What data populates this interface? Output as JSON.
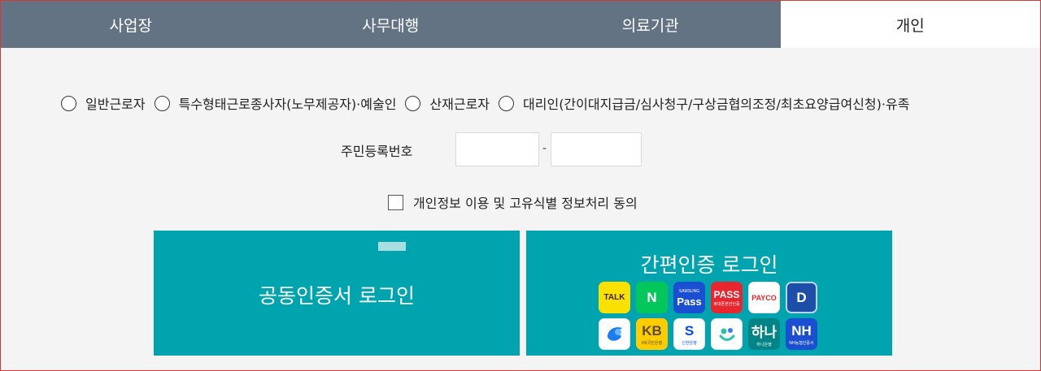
{
  "tabs": [
    {
      "label": "사업장",
      "active": false
    },
    {
      "label": "사무대행",
      "active": false
    },
    {
      "label": "의료기관",
      "active": false
    },
    {
      "label": "개인",
      "active": true
    }
  ],
  "user_types": [
    {
      "label": "일반근로자"
    },
    {
      "label": "특수형태근로종사자(노무제공자)·예술인"
    },
    {
      "label": "산재근로자"
    },
    {
      "label": "대리인(간이대지급금/심사청구/구상금협의조정/최초요양급여신청)·유족"
    }
  ],
  "ssn": {
    "label": "주민등록번호",
    "separator": "-"
  },
  "consent": {
    "label": "개인정보 이용 및 고유식별 정보처리 동의"
  },
  "login": {
    "joint_cert_label": "공동인증서 로그인",
    "simple_auth_label": "간편인증 로그인"
  },
  "auth_providers": [
    {
      "name": "kakao-icon",
      "text": "TALK",
      "sub": "",
      "bg": "#fae100",
      "fg": "#3c1e1e"
    },
    {
      "name": "naver-icon",
      "text": "N",
      "sub": "",
      "bg": "#03c75a",
      "fg": "#ffffff"
    },
    {
      "name": "samsung-pass-icon",
      "text": "Pass",
      "sub": "SAMSUNG",
      "bg": "#1b4fd1",
      "fg": "#ffffff"
    },
    {
      "name": "pass-icon",
      "text": "PASS",
      "sub": "휴대폰본인인증",
      "bg": "#e8262f",
      "fg": "#ffffff"
    },
    {
      "name": "payco-icon",
      "text": "PAYCO",
      "sub": "",
      "bg": "#ffffff",
      "fg": "#e8262f"
    },
    {
      "name": "dream-security-icon",
      "text": "D",
      "sub": "",
      "bg": "#1e4fa8",
      "fg": "#ffffff"
    },
    {
      "name": "toss-icon",
      "text": "",
      "sub": "",
      "bg": "#ffffff",
      "fg": "#1a7df0"
    },
    {
      "name": "kb-bank-icon",
      "text": "KB",
      "sub": "KB국민은행",
      "bg": "#ffcc00",
      "fg": "#5a4a3a"
    },
    {
      "name": "shinhan-bank-icon",
      "text": "S",
      "sub": "신한은행",
      "bg": "#ffffff",
      "fg": "#0046ff"
    },
    {
      "name": "banksalad-icon",
      "text": "",
      "sub": "",
      "bg": "#ffffff",
      "fg": "#2bc3a8"
    },
    {
      "name": "hana-bank-icon",
      "text": "하나",
      "sub": "하나은행",
      "bg": "#008485",
      "fg": "#ffffff"
    },
    {
      "name": "nh-icon",
      "text": "NH",
      "sub": "NH농협인증서",
      "bg": "#1b4fd1",
      "fg": "#ffffff"
    }
  ]
}
